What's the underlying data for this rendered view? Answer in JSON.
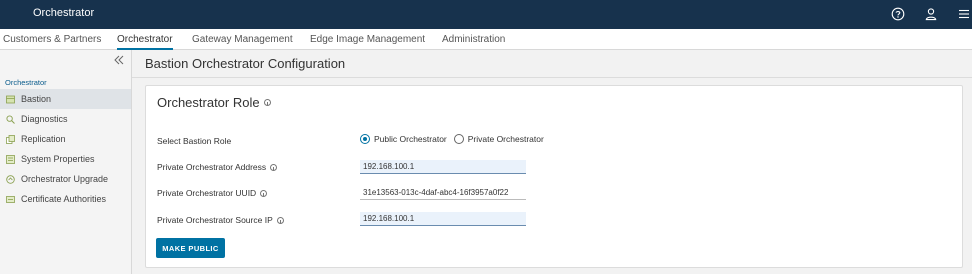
{
  "header": {
    "app_title": "Orchestrator",
    "icons": [
      "help-circle-icon",
      "user-icon",
      "hamburger-menu-icon"
    ]
  },
  "tabs": [
    {
      "label": "Customers & Partners",
      "active": false
    },
    {
      "label": "Orchestrator",
      "active": true
    },
    {
      "label": "Gateway Management",
      "active": false
    },
    {
      "label": "Edge Image Management",
      "active": false
    },
    {
      "label": "Administration",
      "active": false
    }
  ],
  "sidebar": {
    "section_label": "Orchestrator",
    "items": [
      {
        "label": "Bastion",
        "icon": "bastion-icon",
        "active": true
      },
      {
        "label": "Diagnostics",
        "icon": "diagnostics-icon",
        "active": false
      },
      {
        "label": "Replication",
        "icon": "replication-icon",
        "active": false
      },
      {
        "label": "System Properties",
        "icon": "system-properties-icon",
        "active": false
      },
      {
        "label": "Orchestrator Upgrade",
        "icon": "upgrade-icon",
        "active": false
      },
      {
        "label": "Certificate Authorities",
        "icon": "certificate-icon",
        "active": false
      }
    ]
  },
  "main": {
    "page_title": "Bastion Orchestrator Configuration",
    "card": {
      "title": "Orchestrator Role",
      "select_role_label": "Select Bastion Role",
      "role_options": [
        {
          "label": "Public Orchestrator",
          "checked": true
        },
        {
          "label": "Private Orchestrator",
          "checked": false
        }
      ],
      "address_label": "Private Orchestrator Address",
      "address_value": "192.168.100.1",
      "uuid_label": "Private Orchestrator UUID",
      "uuid_value": "31e13563-013c-4daf-abc4-16f3957a0f22",
      "source_ip_label": "Private Orchestrator Source IP",
      "source_ip_value": "192.168.100.1",
      "make_public_label": "MAKE PUBLIC"
    }
  },
  "colors": {
    "header_bg": "#17324d",
    "accent": "#0072a3",
    "sidebar_bg": "#f4f4f4",
    "main_bg": "#f2f2f2"
  }
}
